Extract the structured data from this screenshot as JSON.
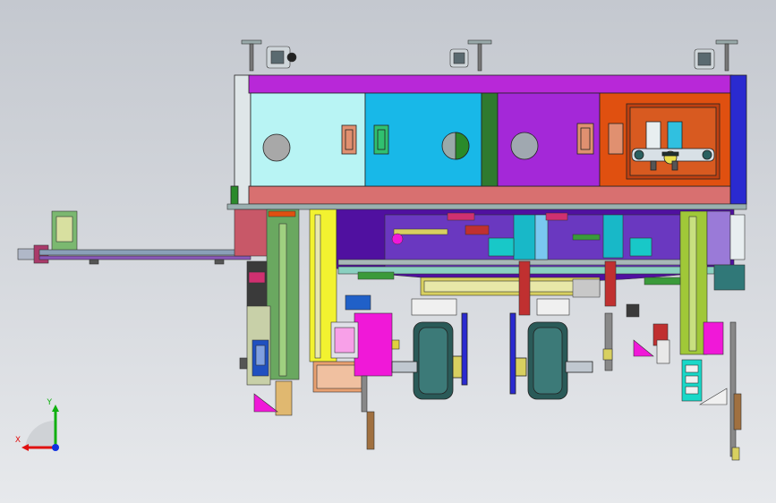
{
  "triad": {
    "x_label": "X",
    "y_label": "Y",
    "colors": {
      "x": "#e01010",
      "y": "#10b010",
      "z": "#1030e0"
    }
  },
  "palette": {
    "frame": "#6a6a6a",
    "magenta": "#b020d0",
    "cyan_light": "#b8f4f4",
    "cyan": "#18b8e8",
    "green_dark": "#2f7a2f",
    "violet": "#a428d8",
    "orange": "#e05010",
    "blue": "#2020c8",
    "salmon": "#d87070",
    "purple_deep": "#5010a0",
    "yellow": "#f2f230",
    "pink": "#f018d8",
    "lime": "#a0c838",
    "teal": "#307878"
  }
}
